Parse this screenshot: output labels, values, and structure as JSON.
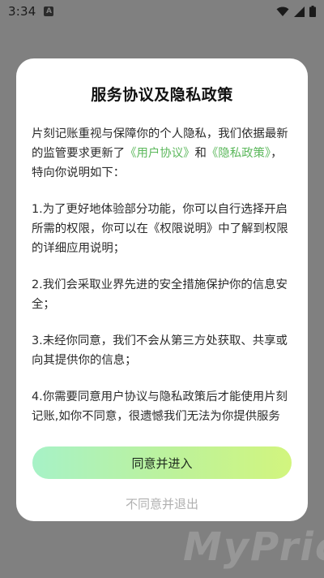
{
  "status_bar": {
    "time": "3:34",
    "notification_glyph": "A",
    "icons": [
      "wifi-icon",
      "signal-icon",
      "battery-icon"
    ]
  },
  "dialog": {
    "title": "服务协议及隐私政策",
    "intro_before": "片刻记账重视与保障你的个人隐私，我们依据最新的监管要求更新了",
    "user_agreement_link": "《用户协议》",
    "intro_and": "和",
    "privacy_policy_link": "《隐私政策》",
    "intro_after": "，特向你说明如下：",
    "points": [
      "1.为了更好地体验部分功能，你可以自行选择开启所需的权限，你可以在《权限说明》中了解到权限的详细应用说明；",
      "2.我们会采取业界先进的安全措施保护你的信息安全；",
      "3.未经你同意，我们不会从第三方处获取、共享或向其提供你的信息；",
      "4.你需要同意用户协议与隐私政策后才能使用片刻记账,如你不同意，很遗憾我们无法为你提供服务"
    ],
    "agree_label": "同意并进入",
    "disagree_label": "不同意并退出",
    "link_color": "#5cb85c"
  },
  "watermark": "MyPrice"
}
